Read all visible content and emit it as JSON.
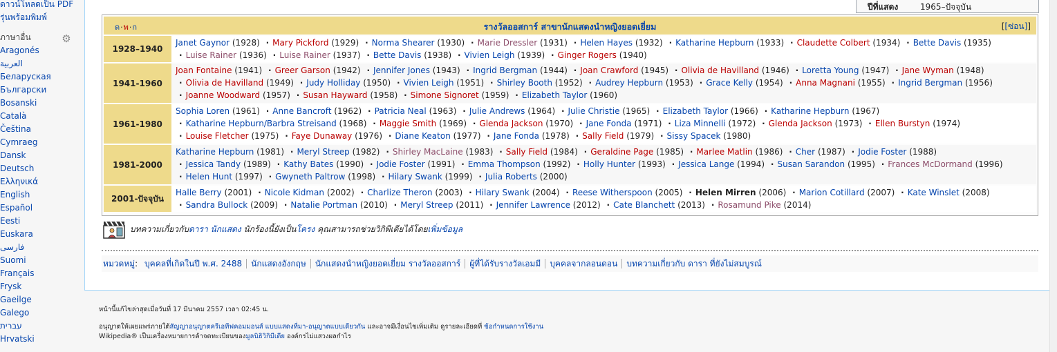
{
  "sidebar": {
    "top_items": [
      "ดาวน์โหลดเป็น PDF",
      "รุ่นพร้อมพิมพ์"
    ],
    "lang_header": "ภาษาอื่น",
    "languages": [
      "Aragonés",
      "العربية",
      "Беларуская",
      "Български",
      "Bosanski",
      "Català",
      "Čeština",
      "Cymraeg",
      "Dansk",
      "Deutsch",
      "Ελληνικά",
      "English",
      "Español",
      "Eesti",
      "Euskara",
      "فارسی",
      "Suomi",
      "Français",
      "Frysk",
      "Gaeilge",
      "Galego",
      "עברית",
      "Hrvatski"
    ]
  },
  "infobox": {
    "key": "ปีที่แสดง",
    "value": "1965–ปัจจุบัน"
  },
  "navbox": {
    "vte": [
      "ด",
      "พ",
      "ก"
    ],
    "title": "รางวัลออสการ์ สาขานักแสดงนำหญิงยอดเยี่ยม",
    "hide_label": "[ซ่อน]",
    "groups": [
      {
        "label": "1928–1940",
        "items": [
          {
            "name": "Janet Gaynor",
            "year": "(1928)",
            "c": "lnk"
          },
          {
            "name": "Mary Pickford",
            "year": "(1929)",
            "c": "red"
          },
          {
            "name": "Norma Shearer",
            "year": "(1930)",
            "c": "lnk"
          },
          {
            "name": "Marie Dressler",
            "year": "(1931)",
            "c": "visited"
          },
          {
            "name": "Helen Hayes",
            "year": "(1932)",
            "c": "lnk"
          },
          {
            "name": "Katharine Hepburn",
            "year": "(1933)",
            "c": "lnk"
          },
          {
            "name": "Claudette Colbert",
            "year": "(1934)",
            "c": "red"
          },
          {
            "name": "Bette Davis",
            "year": "(1935)",
            "c": "lnk"
          },
          {
            "name": "Luise Rainer",
            "year": "(1936)",
            "c": "visited"
          },
          {
            "name": "Luise Rainer",
            "year": "(1937)",
            "c": "visited"
          },
          {
            "name": "Bette Davis",
            "year": "(1938)",
            "c": "lnk"
          },
          {
            "name": "Vivien Leigh",
            "year": "(1939)",
            "c": "lnk"
          },
          {
            "name": "Ginger Rogers",
            "year": "(1940)",
            "c": "red"
          }
        ]
      },
      {
        "label": "1941-1960",
        "items": [
          {
            "name": "Joan Fontaine",
            "year": "(1941)",
            "c": "red"
          },
          {
            "name": "Greer Garson",
            "year": "(1942)",
            "c": "red"
          },
          {
            "name": "Jennifer Jones",
            "year": "(1943)",
            "c": "lnk"
          },
          {
            "name": "Ingrid Bergman",
            "year": "(1944)",
            "c": "lnk"
          },
          {
            "name": "Joan Crawford",
            "year": "(1945)",
            "c": "red"
          },
          {
            "name": "Olivia de Havilland",
            "year": "(1946)",
            "c": "red"
          },
          {
            "name": "Loretta Young",
            "year": "(1947)",
            "c": "lnk"
          },
          {
            "name": "Jane Wyman",
            "year": "(1948)",
            "c": "red"
          },
          {
            "name": "Olivia de Havilland",
            "year": "(1949)",
            "c": "red"
          },
          {
            "name": "Judy Holliday",
            "year": "(1950)",
            "c": "lnk"
          },
          {
            "name": "Vivien Leigh",
            "year": "(1951)",
            "c": "lnk"
          },
          {
            "name": "Shirley Booth",
            "year": "(1952)",
            "c": "lnk"
          },
          {
            "name": "Audrey Hepburn",
            "year": "(1953)",
            "c": "lnk"
          },
          {
            "name": "Grace Kelly",
            "year": "(1954)",
            "c": "lnk"
          },
          {
            "name": "Anna Magnani",
            "year": "(1955)",
            "c": "red"
          },
          {
            "name": "Ingrid Bergman",
            "year": "(1956)",
            "c": "lnk"
          },
          {
            "name": "Joanne Woodward",
            "year": "(1957)",
            "c": "red"
          },
          {
            "name": "Susan Hayward",
            "year": "(1958)",
            "c": "red"
          },
          {
            "name": "Simone Signoret",
            "year": "(1959)",
            "c": "red"
          },
          {
            "name": "Elizabeth Taylor",
            "year": "(1960)",
            "c": "lnk"
          }
        ]
      },
      {
        "label": "1961-1980",
        "items": [
          {
            "name": "Sophia Loren",
            "year": "(1961)",
            "c": "lnk"
          },
          {
            "name": "Anne Bancroft",
            "year": "(1962)",
            "c": "lnk"
          },
          {
            "name": "Patricia Neal",
            "year": "(1963)",
            "c": "lnk"
          },
          {
            "name": "Julie Andrews",
            "year": "(1964)",
            "c": "lnk"
          },
          {
            "name": "Julie Christie",
            "year": "(1965)",
            "c": "lnk"
          },
          {
            "name": "Elizabeth Taylor",
            "year": "(1966)",
            "c": "lnk"
          },
          {
            "name": "Katharine Hepburn",
            "year": "(1967)",
            "c": "lnk"
          },
          {
            "name": "Katharine Hepburn/Barbra Streisand",
            "year": "(1968)",
            "c": "lnk"
          },
          {
            "name": "Maggie Smith",
            "year": "(1969)",
            "c": "red"
          },
          {
            "name": "Glenda Jackson",
            "year": "(1970)",
            "c": "red"
          },
          {
            "name": "Jane Fonda",
            "year": "(1971)",
            "c": "lnk"
          },
          {
            "name": "Liza Minnelli",
            "year": "(1972)",
            "c": "lnk"
          },
          {
            "name": "Glenda Jackson",
            "year": "(1973)",
            "c": "red"
          },
          {
            "name": "Ellen Burstyn",
            "year": "(1974)",
            "c": "red"
          },
          {
            "name": "Louise Fletcher",
            "year": "(1975)",
            "c": "red"
          },
          {
            "name": "Faye Dunaway",
            "year": "(1976)",
            "c": "red"
          },
          {
            "name": "Diane Keaton",
            "year": "(1977)",
            "c": "lnk"
          },
          {
            "name": "Jane Fonda",
            "year": "(1978)",
            "c": "lnk"
          },
          {
            "name": "Sally Field",
            "year": "(1979)",
            "c": "red"
          },
          {
            "name": "Sissy Spacek",
            "year": "(1980)",
            "c": "lnk"
          }
        ]
      },
      {
        "label": "1981-2000",
        "items": [
          {
            "name": "Katharine Hepburn",
            "year": "(1981)",
            "c": "lnk"
          },
          {
            "name": "Meryl Streep",
            "year": "(1982)",
            "c": "lnk"
          },
          {
            "name": "Shirley MacLaine",
            "year": "(1983)",
            "c": "visited"
          },
          {
            "name": "Sally Field",
            "year": "(1984)",
            "c": "red"
          },
          {
            "name": "Geraldine Page",
            "year": "(1985)",
            "c": "red"
          },
          {
            "name": "Marlee Matlin",
            "year": "(1986)",
            "c": "red"
          },
          {
            "name": "Cher",
            "year": "(1987)",
            "c": "lnk"
          },
          {
            "name": "Jodie Foster",
            "year": "(1988)",
            "c": "lnk"
          },
          {
            "name": "Jessica Tandy",
            "year": "(1989)",
            "c": "lnk"
          },
          {
            "name": "Kathy Bates",
            "year": "(1990)",
            "c": "lnk"
          },
          {
            "name": "Jodie Foster",
            "year": "(1991)",
            "c": "lnk"
          },
          {
            "name": "Emma Thompson",
            "year": "(1992)",
            "c": "lnk"
          },
          {
            "name": "Holly Hunter",
            "year": "(1993)",
            "c": "lnk"
          },
          {
            "name": "Jessica Lange",
            "year": "(1994)",
            "c": "lnk"
          },
          {
            "name": "Susan Sarandon",
            "year": "(1995)",
            "c": "lnk"
          },
          {
            "name": "Frances McDormand",
            "year": "(1996)",
            "c": "visited"
          },
          {
            "name": "Helen Hunt",
            "year": "(1997)",
            "c": "lnk"
          },
          {
            "name": "Gwyneth Paltrow",
            "year": "(1998)",
            "c": "lnk"
          },
          {
            "name": "Hilary Swank",
            "year": "(1999)",
            "c": "lnk"
          },
          {
            "name": "Julia Roberts",
            "year": "(2000)",
            "c": "lnk"
          }
        ]
      },
      {
        "label": "2001-ปัจจุบัน",
        "items": [
          {
            "name": "Halle Berry",
            "year": "(2001)",
            "c": "lnk"
          },
          {
            "name": "Nicole Kidman",
            "year": "(2002)",
            "c": "lnk"
          },
          {
            "name": "Charlize Theron",
            "year": "(2003)",
            "c": "lnk"
          },
          {
            "name": "Hilary Swank",
            "year": "(2004)",
            "c": "lnk"
          },
          {
            "name": "Reese Witherspoon",
            "year": "(2005)",
            "c": "lnk"
          },
          {
            "name": "Helen Mirren",
            "year": "(2006)",
            "c": "bold"
          },
          {
            "name": "Marion Cotillard",
            "year": "(2007)",
            "c": "lnk"
          },
          {
            "name": "Kate Winslet",
            "year": "(2008)",
            "c": "lnk"
          },
          {
            "name": "Sandra Bullock",
            "year": "(2009)",
            "c": "lnk"
          },
          {
            "name": "Natalie Portman",
            "year": "(2010)",
            "c": "lnk"
          },
          {
            "name": "Meryl Streep",
            "year": "(2011)",
            "c": "lnk"
          },
          {
            "name": "Jennifer Lawrence",
            "year": "(2012)",
            "c": "lnk"
          },
          {
            "name": "Cate Blanchett",
            "year": "(2013)",
            "c": "lnk"
          },
          {
            "name": "Rosamund Pike",
            "year": "(2014)",
            "c": "visited"
          }
        ]
      }
    ]
  },
  "stub": {
    "prefix": "บทความเกี่ยวกับ",
    "link1": "ดารา",
    "space": " ",
    "link2": "นักแสดง",
    "mid": " นักร้องนี้ยังเป็น",
    "link3": "โครง",
    "after": " คุณสามารถช่วยวิกิพีเดียได้โดย",
    "link4": "เพิ่มข้อมูล"
  },
  "categories": {
    "label": "หมวดหมู่",
    "colon": ":",
    "items": [
      "บุคคลที่เกิดในปี พ.ศ. 2488",
      "นักแสดงอังกฤษ",
      "นักแสดงนำหญิงยอดเยี่ยม รางวัลออสการ์",
      "ผู้ที่ได้รับรางวัลเอมมี",
      "บุคคลจากลอนดอน",
      "บทความเกี่ยวกับ ดารา ที่ยังไม่สมบูรณ์"
    ]
  },
  "footer": {
    "modified": "หน้านี้แก้ไขล่าสุดเมื่อวันที่ 17 มีนาคม 2557 เวลา 02:45 น.",
    "license_pre": "อนุญาตให้เผยแพร่ภายใต้",
    "license_link": "สัญญาอนุญาตครีเอทีฟคอมมอนส์ แบบแสดงที่มา-อนุญาตแบบเดียวกัน",
    "license_mid": " และอาจมีเงื่อนไขเพิ่มเติม ดูรายละเอียดที่ ",
    "terms_link": "ข้อกำหนดการใช้งาน",
    "wm_pre": "Wikipedia® เป็นเครื่องหมายการค้าจดทะเบียนของ",
    "wm_link": "มูลนิธิวิกิมีเดีย",
    "wm_post": " องค์กรไม่แสวงผลกำไร"
  }
}
